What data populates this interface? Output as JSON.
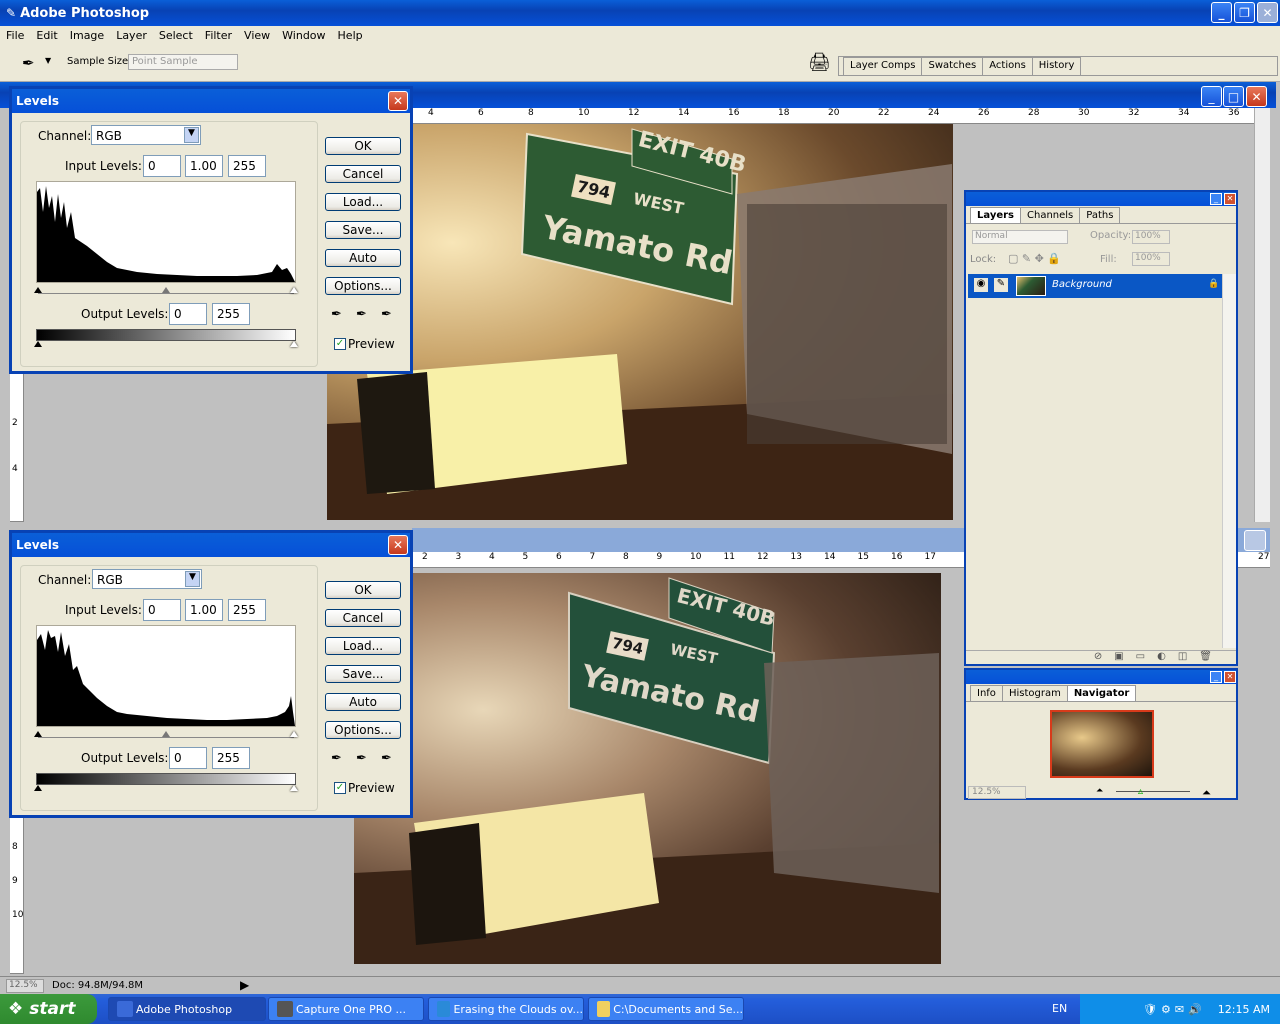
{
  "app": {
    "title": "Adobe Photoshop"
  },
  "menu": [
    "File",
    "Edit",
    "Image",
    "Layer",
    "Select",
    "Filter",
    "View",
    "Window",
    "Help"
  ],
  "options": {
    "sample_label": "Sample Size:",
    "sample_value": "Point Sample"
  },
  "dock_tabs": [
    "Layer Comps",
    "Swatches",
    "Actions",
    "History"
  ],
  "levels": [
    {
      "title": "Levels",
      "channel_label": "Channel:",
      "channel": "RGB",
      "input_label": "Input Levels:",
      "in_black": "0",
      "in_gamma": "1.00",
      "in_white": "255",
      "output_label": "Output Levels:",
      "out_black": "0",
      "out_white": "255",
      "buttons": [
        "OK",
        "Cancel",
        "Load...",
        "Save...",
        "Auto",
        "Options..."
      ],
      "preview": "Preview"
    },
    {
      "title": "Levels",
      "channel_label": "Channel:",
      "channel": "RGB",
      "input_label": "Input Levels:",
      "in_black": "0",
      "in_gamma": "1.00",
      "in_white": "255",
      "output_label": "Output Levels:",
      "out_black": "0",
      "out_white": "255",
      "buttons": [
        "OK",
        "Cancel",
        "Load...",
        "Save...",
        "Auto",
        "Options..."
      ],
      "preview": "Preview"
    }
  ],
  "ruler_top": [
    "4",
    "6",
    "8",
    "10",
    "12",
    "14",
    "16",
    "18",
    "20",
    "22",
    "24",
    "26",
    "28",
    "30",
    "32",
    "34",
    "36"
  ],
  "ruler_bottom": [
    "2",
    "3",
    "4",
    "5",
    "6",
    "7",
    "8",
    "9",
    "10",
    "11",
    "12",
    "13",
    "14",
    "15",
    "16",
    "17"
  ],
  "ruler_bottom_right": "27",
  "ruler_left_top": [
    "2",
    "4"
  ],
  "ruler_left_bottom": [
    "8",
    "9",
    "10"
  ],
  "layers": {
    "tabs": [
      "Layers",
      "Channels",
      "Paths"
    ],
    "blend": "Normal",
    "opacity_label": "Opacity:",
    "opacity": "100%",
    "lock_label": "Lock:",
    "fill_label": "Fill:",
    "fill": "100%",
    "layer_name": "Background"
  },
  "navigator": {
    "tabs": [
      "Info",
      "Histogram",
      "Navigator"
    ],
    "zoom": "12.5%"
  },
  "status": {
    "zoom": "12.5%",
    "doc": "Doc: 94.8M/94.8M"
  },
  "sign": {
    "exit": "EXIT 40B",
    "route": "794",
    "west": "WEST",
    "road": "Yamato Rd"
  },
  "taskbar": {
    "start": "start",
    "tasks": [
      "Adobe Photoshop",
      "Capture One PRO ...",
      "Erasing the Clouds ov...",
      "C:\\Documents and Se..."
    ],
    "lang": "EN",
    "time": "12:15 AM"
  },
  "colors": {
    "accent": "#0842b4",
    "chrome": "#ece9d8",
    "selection": "#0a57c5"
  }
}
